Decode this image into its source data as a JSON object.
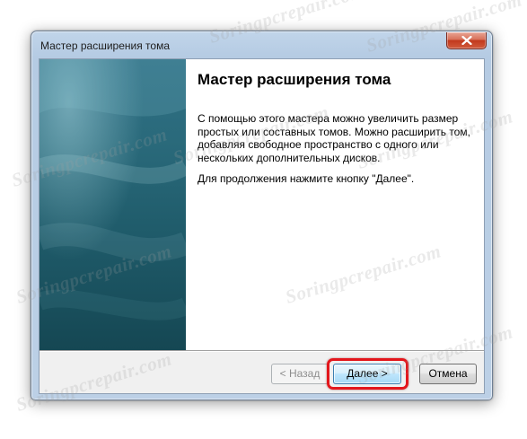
{
  "window": {
    "title": "Мастер расширения тома"
  },
  "titlebar": {
    "close_icon": "close-icon"
  },
  "content": {
    "heading": "Мастер расширения тома",
    "paragraph1": "С помощью этого мастера можно увеличить размер простых или составных томов. Можно расширить том, добавляя свободное пространство с одного или нескольких дополнительных дисков.",
    "paragraph2": "Для продолжения нажмите кнопку \"Далее\"."
  },
  "buttons": {
    "back_label": "< Назад",
    "next_label": "Далее >",
    "cancel_label": "Отмена"
  },
  "watermark": {
    "text": "Soringpcrepair.com"
  },
  "colors": {
    "highlight": "#e3161c",
    "banner": "#2a6a7b",
    "close_button": "#c1391d"
  }
}
